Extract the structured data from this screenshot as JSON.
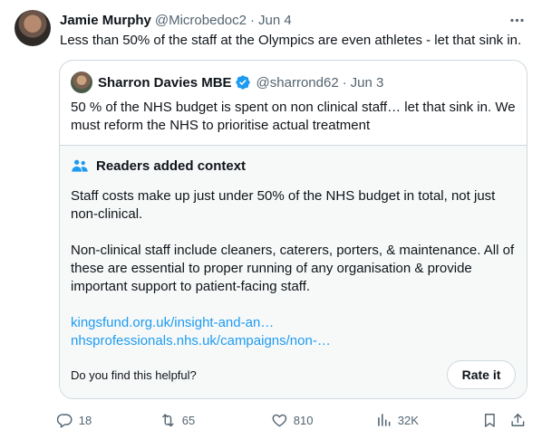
{
  "tweet": {
    "author_name": "Jamie Murphy",
    "author_handle": "@Microbedoc2",
    "separator": "·",
    "date": "Jun 4",
    "text": "Less than 50% of the staff at the Olympics are even athletes - let that sink in.",
    "more_icon": "more-horizontal-icon"
  },
  "quoted": {
    "author_name": "Sharron Davies MBE",
    "verified": true,
    "author_handle": "@sharrond62",
    "separator": "·",
    "date": "Jun 3",
    "text": "50 % of the NHS budget is spent on non clinical staff… let that sink in. We must reform the NHS to prioritise actual treatment"
  },
  "context": {
    "heading": "Readers added context",
    "paragraph1": "Staff costs make up just under 50% of the NHS budget in total, not just non-clinical.",
    "paragraph2": "Non-clinical staff include cleaners, caterers, porters, & maintenance. All of these are essential to proper running of any organisation & provide important support to patient-facing staff.",
    "link1": "kingsfund.org.uk/insight-and-an…",
    "link2": "nhsprofessionals.nhs.uk/campaigns/non-…",
    "helpful_prompt": "Do you find this helpful?",
    "rate_label": "Rate it"
  },
  "actions": {
    "replies": "18",
    "retweets": "65",
    "likes": "810",
    "views": "32K"
  },
  "colors": {
    "accent": "#1d9bf0",
    "secondary_text": "#536471",
    "border": "#cfd9de",
    "context_bg": "#f7f9f9"
  }
}
